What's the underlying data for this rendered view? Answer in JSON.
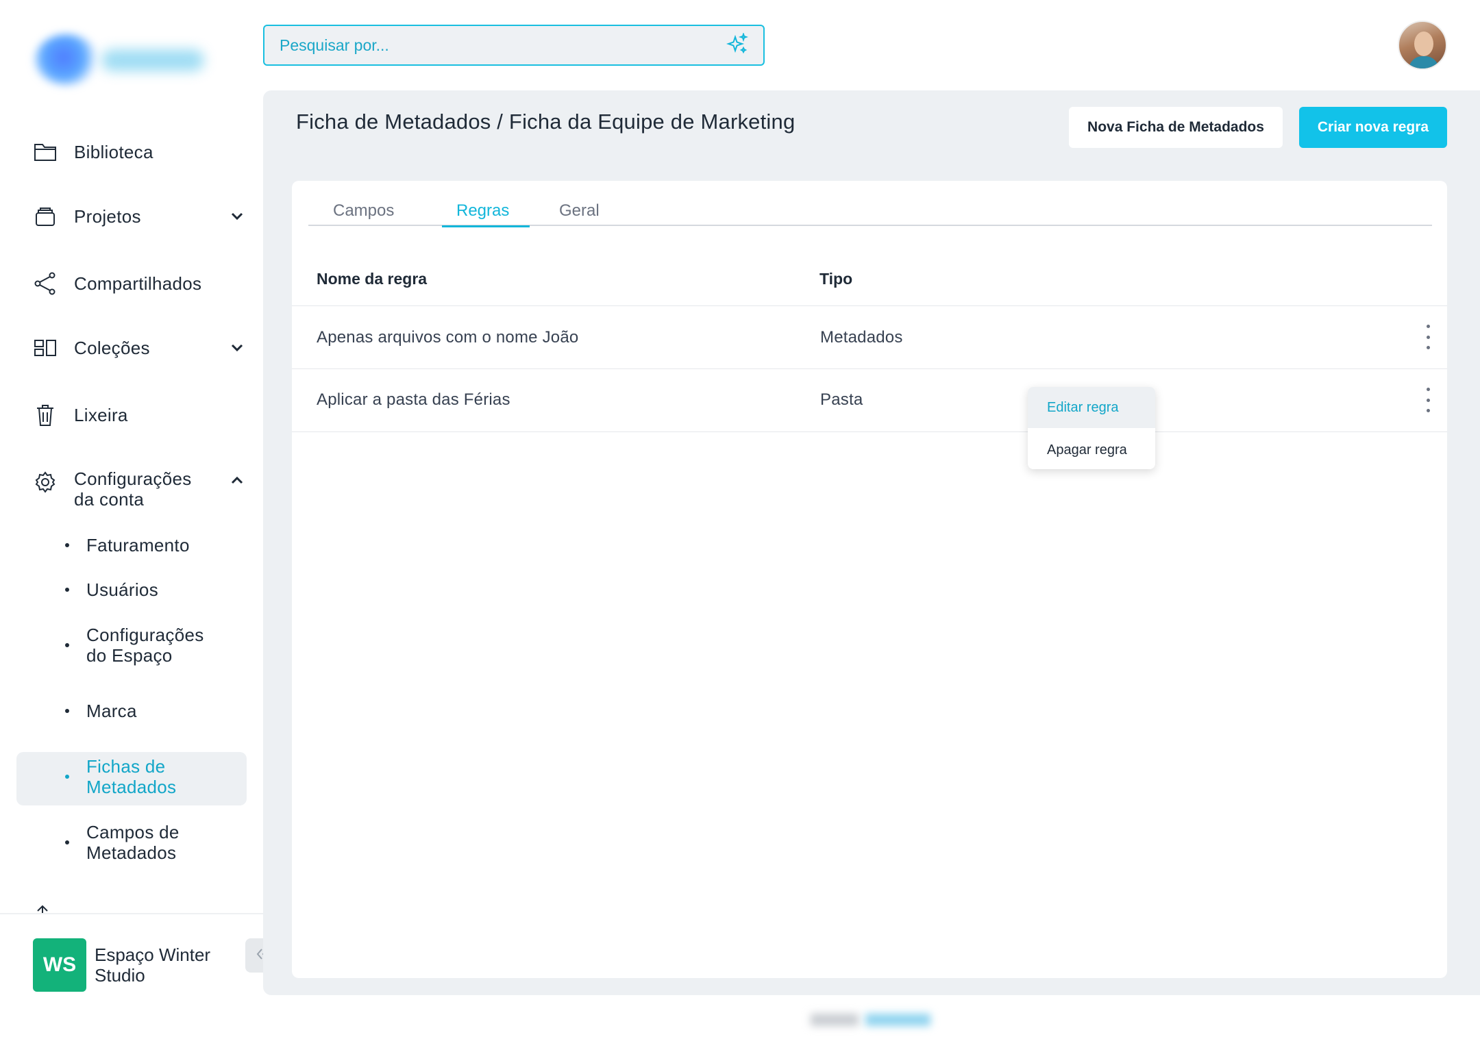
{
  "search": {
    "placeholder": "Pesquisar por..."
  },
  "sidebar": {
    "items": [
      {
        "label": "Biblioteca"
      },
      {
        "label": "Projetos"
      },
      {
        "label": "Compartilhados"
      },
      {
        "label": "Coleções"
      },
      {
        "label": "Lixeira"
      },
      {
        "label": "Configurações da conta"
      }
    ],
    "sub_items": [
      {
        "label_1": "Faturamento",
        "label_2": ""
      },
      {
        "label_1": "Usuários",
        "label_2": ""
      },
      {
        "label_1": "Configurações",
        "label_2": "do Espaço"
      },
      {
        "label_1": "Marca",
        "label_2": ""
      },
      {
        "label_1": "Fichas de",
        "label_2": "Metadados"
      },
      {
        "label_1": "Campos de",
        "label_2": "Metadados"
      }
    ],
    "workspace": {
      "initials": "WS",
      "name": "Espaço Winter Studio"
    }
  },
  "main": {
    "breadcrumb": "Ficha de Metadados / Ficha da Equipe de Marketing",
    "btn_new_sheet": "Nova Ficha de Metadados",
    "btn_create_rule": "Criar nova regra",
    "tabs": [
      {
        "label": "Campos"
      },
      {
        "label": "Regras"
      },
      {
        "label": "Geral"
      }
    ],
    "table": {
      "headers": [
        "Nome da regra",
        "Tipo"
      ],
      "rows": [
        {
          "name": "Apenas arquivos com o nome João",
          "type": "Metadados"
        },
        {
          "name": "Aplicar a pasta das Férias",
          "type": "Pasta"
        }
      ]
    },
    "context_menu": [
      "Editar regra",
      "Apagar regra"
    ]
  },
  "colors": {
    "accent": "#12c2e9",
    "workspace_badge": "#13b27a",
    "panel_bg": "#edf0f3"
  },
  "icons": [
    "folder-icon",
    "projects-icon",
    "share-icon",
    "collections-icon",
    "trash-icon",
    "gear-icon",
    "chevron-down-icon",
    "chevron-up-icon",
    "sparkle-icon",
    "kebab-icon",
    "double-chevron-left-icon"
  ]
}
